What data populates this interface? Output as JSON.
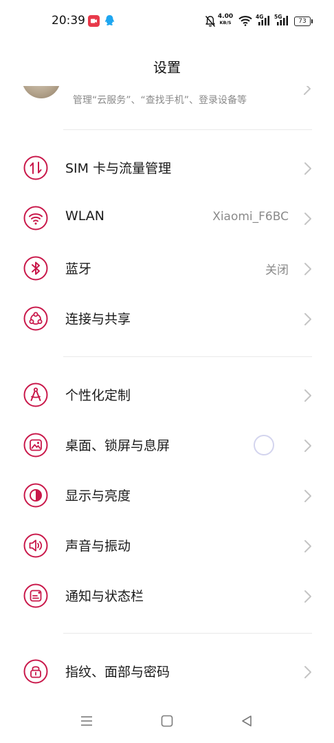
{
  "status_bar": {
    "time": "20:39",
    "net_speed_value": "4.00",
    "net_speed_unit": "KB/S",
    "signal1_label": "4G",
    "signal2_label": "5G",
    "battery": "73",
    "icons": [
      "screen-record-icon",
      "qq-icon",
      "mute-bell-icon",
      "wifi-icon",
      "signal-4g-icon",
      "signal-5g-icon",
      "battery-icon"
    ]
  },
  "header": {
    "title": "设置"
  },
  "account": {
    "subtitle": "管理“云服务”、“查找手机”、登录设备等"
  },
  "settings": {
    "sim": {
      "label": "SIM 卡与流量管理",
      "icon": "sim-data-icon"
    },
    "wlan": {
      "label": "WLAN",
      "value": "Xiaomi_F6BC",
      "icon": "wifi-icon"
    },
    "bluetooth": {
      "label": "蓝牙",
      "value": "关闭",
      "icon": "bluetooth-icon"
    },
    "connect_share": {
      "label": "连接与共享",
      "icon": "share-icon"
    },
    "personalize": {
      "label": "个性化定制",
      "icon": "compass-icon"
    },
    "desktop": {
      "label": "桌面、锁屏与息屏",
      "icon": "wallpaper-icon"
    },
    "display": {
      "label": "显示与亮度",
      "icon": "brightness-icon"
    },
    "sound": {
      "label": "声音与振动",
      "icon": "speaker-icon"
    },
    "notification": {
      "label": "通知与状态栏",
      "icon": "notification-icon"
    },
    "security": {
      "label": "指纹、面部与密码",
      "icon": "lock-icon"
    }
  },
  "colors": {
    "accent": "#c9184a",
    "chevron": "#c4c4c4",
    "secondary_text": "#8a8a8a",
    "loading": "#d3d4ee"
  },
  "nav_bar": {
    "icons": [
      "menu-icon",
      "home-icon",
      "back-icon"
    ]
  }
}
